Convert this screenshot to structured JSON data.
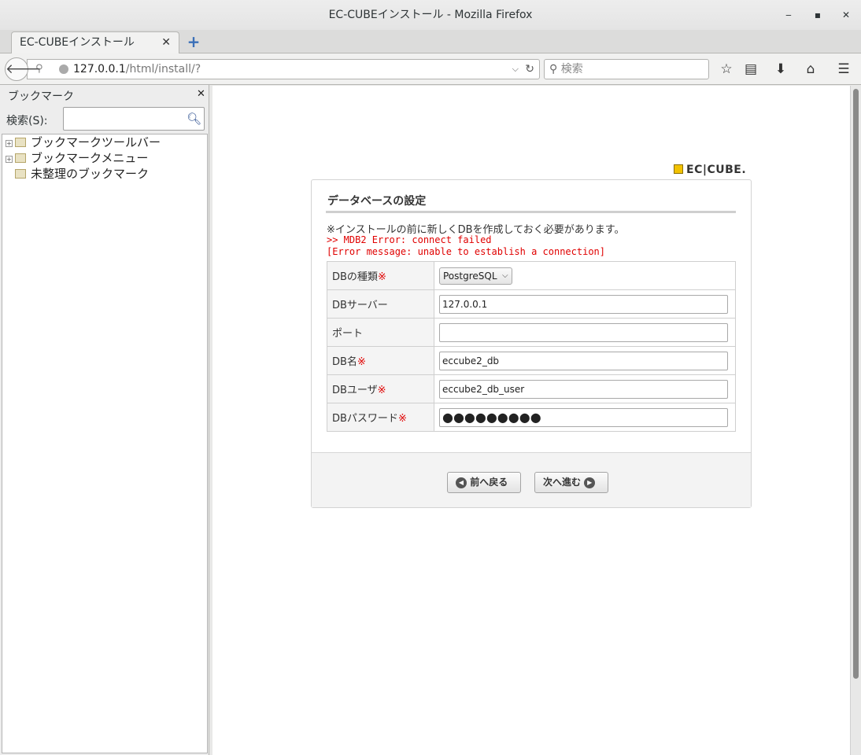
{
  "window": {
    "title": "EC-CUBEインストール - Mozilla Firefox",
    "minimize": "‒",
    "maximize": "▪",
    "close": "✕"
  },
  "tabs": [
    {
      "label": "EC-CUBEインストール",
      "close": "✕"
    }
  ],
  "newtab": "+",
  "navbar": {
    "url_host": "127.0.0.1",
    "url_path": "/html/install/?",
    "search_placeholder": "検索"
  },
  "sidebar": {
    "title": "ブックマーク",
    "close": "✕",
    "search_label": "検索(S):",
    "items": [
      {
        "label": "ブックマークツールバー"
      },
      {
        "label": "ブックマークメニュー"
      },
      {
        "label": "未整理のブックマーク"
      }
    ]
  },
  "logo": "EC|CUBE.",
  "install": {
    "title": "データベースの設定",
    "note": "※インストールの前に新しくDBを作成しておく必要があります。",
    "errors": [
      ">> MDB2 Error: connect failed",
      "[Error message: unable to establish a connection]"
    ],
    "required_mark": "※",
    "fields": {
      "db_type": {
        "label": "DBの種類",
        "value": "PostgreSQL"
      },
      "db_server": {
        "label": "DBサーバー",
        "value": "127.0.0.1"
      },
      "db_port": {
        "label": "ポート",
        "value": ""
      },
      "db_name": {
        "label": "DB名",
        "value": "eccube2_db"
      },
      "db_user": {
        "label": "DBユーザ",
        "value": "eccube2_db_user"
      },
      "db_password": {
        "label": "DBパスワード",
        "value": "●●●●●●●●●"
      }
    },
    "back_button": "前へ戻る",
    "next_button": "次へ進む"
  }
}
